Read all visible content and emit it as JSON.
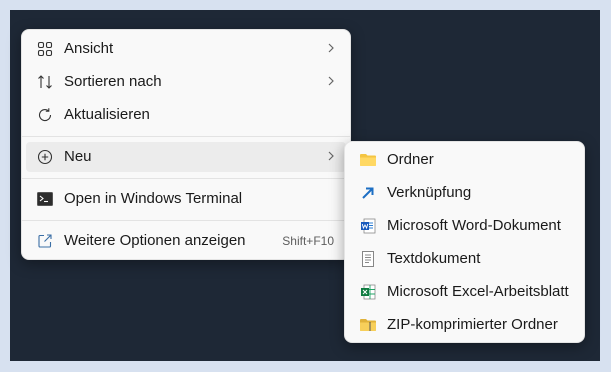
{
  "context_menu": {
    "items": [
      {
        "label": "Ansicht",
        "icon": "grid-view-icon"
      },
      {
        "label": "Sortieren nach",
        "icon": "sort-icon"
      },
      {
        "label": "Aktualisieren",
        "icon": "refresh-icon"
      },
      {
        "label": "Neu",
        "icon": "add-circle-icon"
      },
      {
        "label": "Open in Windows Terminal",
        "icon": "terminal-icon"
      },
      {
        "label": "Weitere Optionen anzeigen",
        "icon": "share-icon",
        "shortcut": "Shift+F10"
      }
    ]
  },
  "submenu_new": {
    "items": [
      {
        "label": "Ordner",
        "icon": "folder-icon"
      },
      {
        "label": "Verknüpfung",
        "icon": "shortcut-arrow-icon"
      },
      {
        "label": "Microsoft Word-Dokument",
        "icon": "word-document-icon"
      },
      {
        "label": "Textdokument",
        "icon": "text-document-icon"
      },
      {
        "label": "Microsoft Excel-Arbeitsblatt",
        "icon": "excel-sheet-icon"
      },
      {
        "label": "ZIP-komprimierter Ordner",
        "icon": "zip-folder-icon"
      }
    ]
  },
  "colors": {
    "desktop_background": "#1e2836",
    "menu_background": "#f9f9f9",
    "hover_background": "#ececec"
  }
}
